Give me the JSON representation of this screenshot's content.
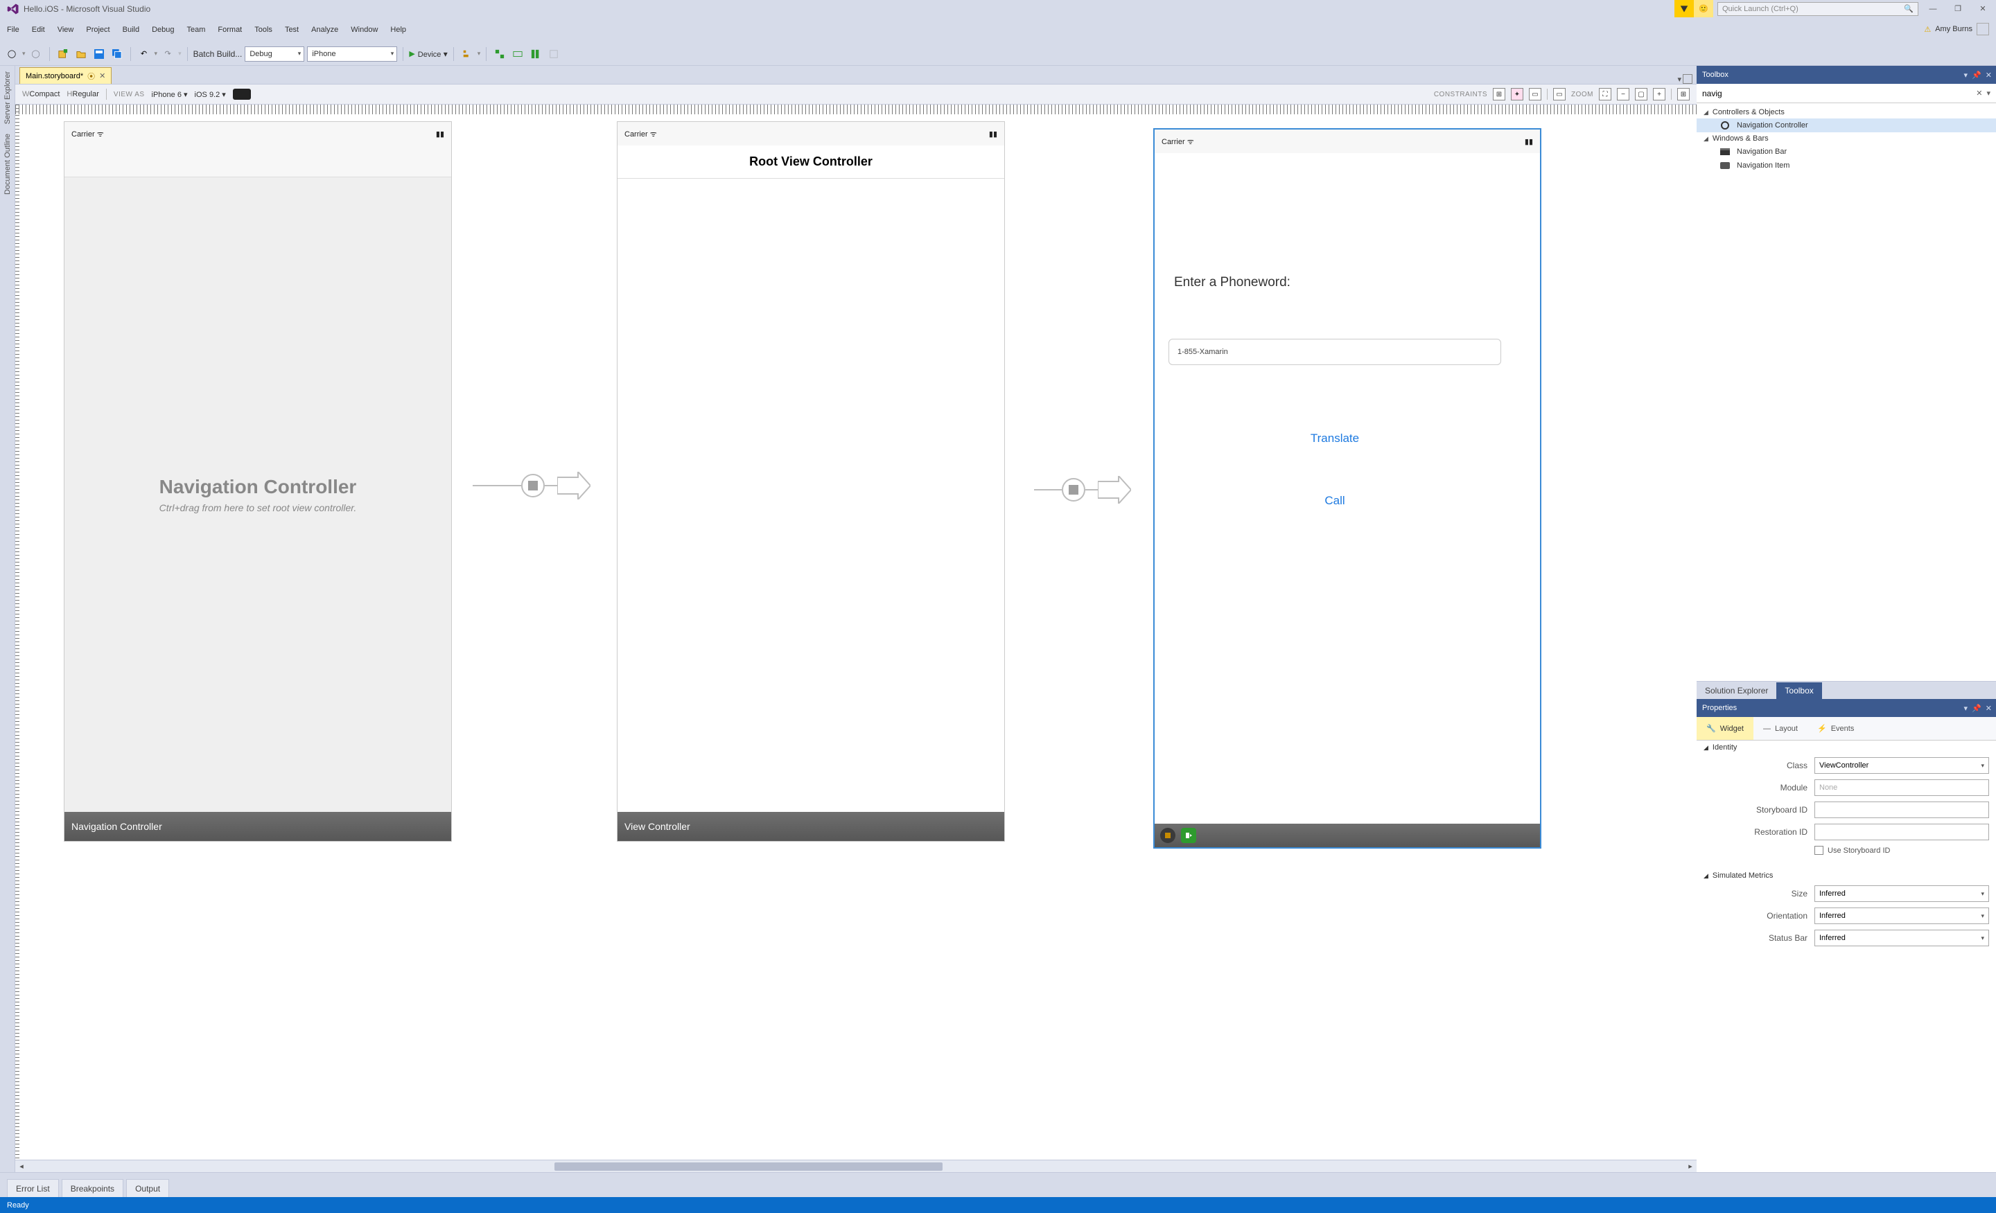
{
  "title": "Hello.iOS - Microsoft Visual Studio",
  "quick_launch_placeholder": "Quick Launch (Ctrl+Q)",
  "user_name": "Amy Burns",
  "menu": [
    "File",
    "Edit",
    "View",
    "Project",
    "Build",
    "Debug",
    "Team",
    "Format",
    "Tools",
    "Test",
    "Analyze",
    "Window",
    "Help"
  ],
  "toolbar": {
    "batch_build": "Batch Build...",
    "config": "Debug",
    "platform": "iPhone",
    "device": "Device"
  },
  "doc_tab": {
    "name": "Main.storyboard*"
  },
  "designer_bar": {
    "sizeclass_w_prefix": "W",
    "sizeclass_w": "Compact",
    "sizeclass_h_prefix": "H",
    "sizeclass_h": "Regular",
    "view_as_label": "VIEW AS",
    "device": "iPhone 6",
    "ios": "iOS 9.2",
    "constraints_label": "CONSTRAINTS",
    "zoom_label": "ZOOM"
  },
  "canvas": {
    "carrier": "Carrier",
    "nav_controller_title": "Navigation Controller",
    "nav_controller_sub": "Ctrl+drag from here to set root view controller.",
    "nav_controller_footer": "Navigation Controller",
    "root_title": "Root View Controller",
    "view_controller_footer": "View Controller",
    "form": {
      "label": "Enter a Phoneword:",
      "value": "1-855-Xamarin",
      "translate": "Translate",
      "call": "Call"
    }
  },
  "bottom_tabs": [
    "Error List",
    "Breakpoints",
    "Output"
  ],
  "status": "Ready",
  "toolbox": {
    "title": "Toolbox",
    "search": "navig",
    "groups": [
      {
        "name": "Controllers & Objects",
        "items": [
          {
            "name": "Navigation Controller",
            "icon": "navctrl",
            "selected": true
          }
        ]
      },
      {
        "name": "Windows & Bars",
        "items": [
          {
            "name": "Navigation Bar",
            "icon": "navbar"
          },
          {
            "name": "Navigation Item",
            "icon": "navitem"
          }
        ]
      }
    ],
    "panel_tabs": [
      "Solution Explorer",
      "Toolbox"
    ]
  },
  "properties": {
    "title": "Properties",
    "tabs": [
      "Widget",
      "Layout",
      "Events"
    ],
    "identity_section": "Identity",
    "fields": {
      "class_label": "Class",
      "class_value": "ViewController",
      "module_label": "Module",
      "module_placeholder": "None",
      "storyboard_id_label": "Storyboard ID",
      "restoration_id_label": "Restoration ID",
      "use_storyboard_id": "Use Storyboard ID"
    },
    "sim_section": "Simulated Metrics",
    "sim": {
      "size_label": "Size",
      "size_value": "Inferred",
      "orientation_label": "Orientation",
      "orientation_value": "Inferred",
      "statusbar_label": "Status Bar",
      "statusbar_value": "Inferred"
    }
  }
}
